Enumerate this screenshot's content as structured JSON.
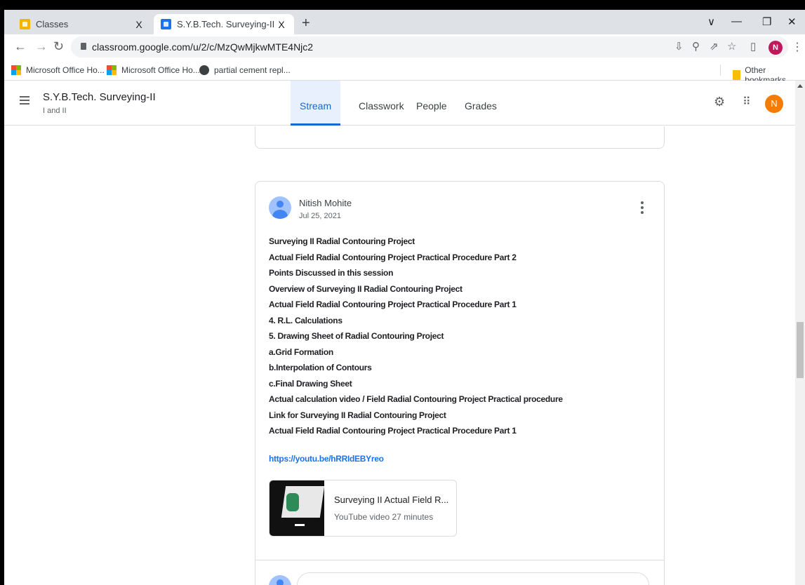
{
  "browser": {
    "tabs": [
      {
        "title": "Classes"
      },
      {
        "title": "S.Y.B.Tech. Surveying-II I and II"
      }
    ],
    "tab_close_glyph": "X",
    "new_tab_glyph": "+",
    "url": "classroom.google.com/u/2/c/MzQwMjkwMTE4Njc2",
    "profile_initial": "N",
    "bookmarks": [
      {
        "label": "Microsoft Office Ho...",
        "icon": "microsoft-icon"
      },
      {
        "label": "Microsoft Office Ho...",
        "icon": "microsoft-icon"
      },
      {
        "label": "partial cement repl...",
        "icon": "globe-icon"
      }
    ],
    "other_bookmarks": "Other bookmarks"
  },
  "classroom": {
    "class_title": "S.Y.B.Tech. Surveying-II",
    "class_subtitle": "I and II",
    "nav_tabs": [
      {
        "label": "Stream",
        "active": true
      },
      {
        "label": "Classwork"
      },
      {
        "label": "People"
      },
      {
        "label": "Grades"
      }
    ],
    "user_initial": "N"
  },
  "post": {
    "author": "Nitish Mohite",
    "date": "Jul 25, 2021",
    "lines": [
      "Surveying II Radial Contouring Project",
      "Actual Field Radial Contouring Project Practical Procedure Part 2",
      "Points Discussed in this session",
      "Overview of Surveying II Radial Contouring Project",
      "Actual Field Radial Contouring Project Practical Procedure Part 1",
      "4. R.L. Calculations",
      "5. Drawing Sheet of Radial Contouring Project",
      "a.Grid Formation",
      "b.Interpolation of Contours",
      "c.Final Drawing Sheet",
      "Actual calculation video / Field Radial Contouring Project Practical procedure",
      "Link for Surveying II Radial Contouring Project",
      "Actual Field Radial Contouring Project Practical Procedure Part 1"
    ],
    "link": "https://youtu.be/hRRIdEBYreo",
    "attachment": {
      "title": "Surveying II Actual Field R...",
      "subtitle": "YouTube video  27 minutes"
    }
  },
  "colors": {
    "accent": "#1967d2",
    "avatar_orange": "#f57c00",
    "profile_pink": "#c2185b"
  }
}
